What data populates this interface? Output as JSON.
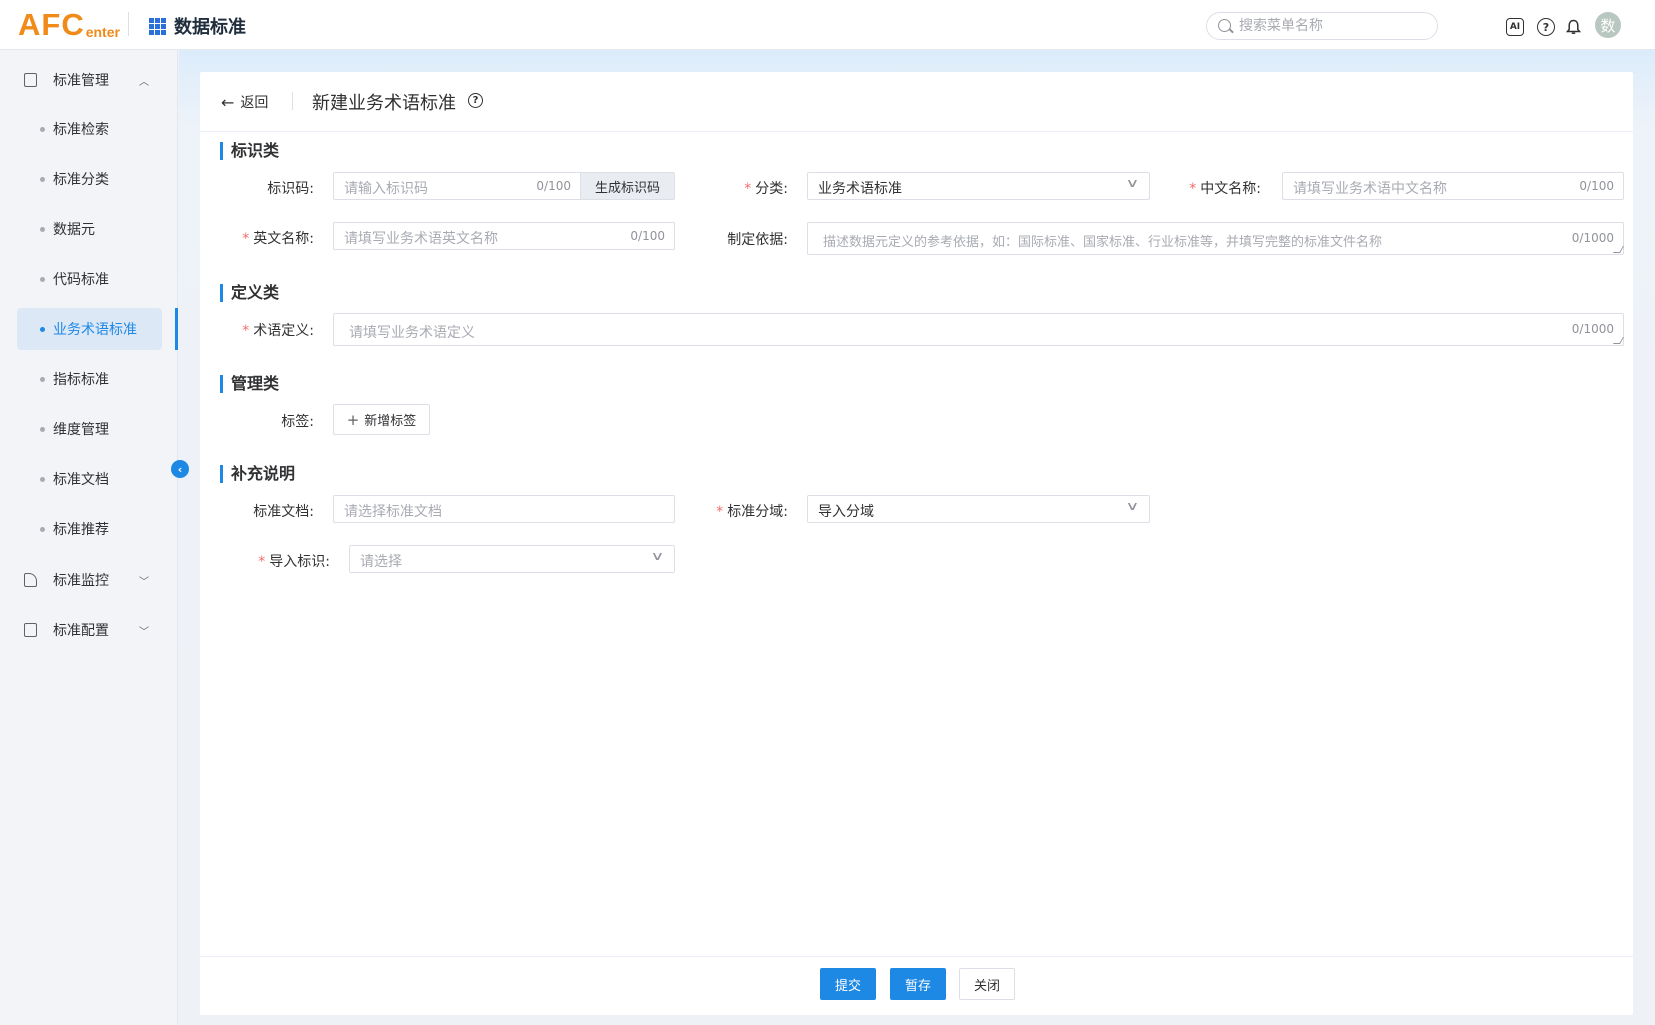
{
  "header": {
    "logo_big": "AFC",
    "logo_small": "enter",
    "app_title": "数据标准",
    "search_placeholder": "搜索菜单名称",
    "ai_label": "AI",
    "help_label": "?",
    "avatar_text": "数"
  },
  "sidebar": {
    "groups": [
      {
        "label": "标准管理",
        "expanded": true
      },
      {
        "label": "标准监控",
        "expanded": false
      },
      {
        "label": "标准配置",
        "expanded": false
      }
    ],
    "items": [
      {
        "label": "标准检索"
      },
      {
        "label": "标准分类"
      },
      {
        "label": "数据元"
      },
      {
        "label": "代码标准"
      },
      {
        "label": "业务术语标准",
        "active": true
      },
      {
        "label": "指标标准"
      },
      {
        "label": "维度管理"
      },
      {
        "label": "标准文档"
      },
      {
        "label": "标准推荐"
      }
    ]
  },
  "page": {
    "back_label": "返回",
    "title": "新建业务术语标准",
    "sections": {
      "identity": "标识类",
      "definition": "定义类",
      "management": "管理类",
      "supplement": "补充说明"
    },
    "fields": {
      "code": {
        "label": "标识码:",
        "placeholder": "请输入标识码",
        "count": "0/100",
        "gen_button": "生成标识码"
      },
      "category": {
        "label": "分类:",
        "value": "业务术语标准"
      },
      "cn_name": {
        "label": "中文名称:",
        "placeholder": "请填写业务术语中文名称",
        "count": "0/100"
      },
      "en_name": {
        "label": "英文名称:",
        "placeholder": "请填写业务术语英文名称",
        "count": "0/100"
      },
      "basis": {
        "label": "制定依据:",
        "placeholder": "描述数据元定义的参考依据，如：国际标准、国家标准、行业标准等，并填写完整的标准文件名称",
        "count": "0/1000"
      },
      "definition": {
        "label": "术语定义:",
        "placeholder": "请填写业务术语定义",
        "count": "0/1000"
      },
      "tags": {
        "label": "标签:",
        "add_button": "新增标签"
      },
      "doc": {
        "label": "标准文档:",
        "placeholder": "请选择标准文档"
      },
      "domain": {
        "label": "标准分域:",
        "value": "导入分域"
      },
      "import_flag": {
        "label": "导入标识:",
        "placeholder": "请选择"
      }
    },
    "footer": {
      "submit": "提交",
      "save_draft": "暂存",
      "close": "关闭"
    }
  },
  "colors": {
    "primary": "#1e88e5",
    "logo": "#f08a19",
    "required": "#f56c6c"
  }
}
